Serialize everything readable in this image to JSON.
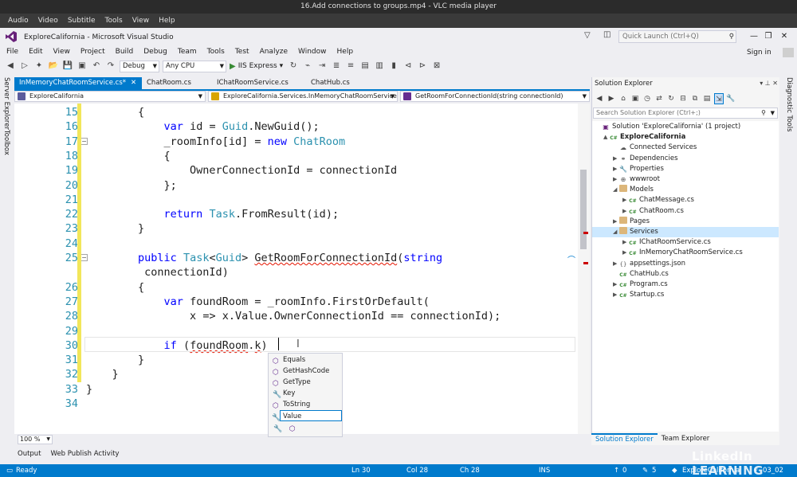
{
  "vlc": {
    "title": "16.Add connections to groups.mp4 - VLC media player",
    "menu": [
      "Audio",
      "Video",
      "Subtitle",
      "Tools",
      "View",
      "Help"
    ]
  },
  "vs": {
    "title": "ExploreCalifornia - Microsoft Visual Studio",
    "quick_launch": "Quick Launch (Ctrl+Q)",
    "menu": [
      "File",
      "Edit",
      "View",
      "Project",
      "Build",
      "Debug",
      "Team",
      "Tools",
      "Test",
      "Analyze",
      "Window",
      "Help"
    ],
    "sign_in": "Sign in",
    "toolbar": {
      "config": "Debug",
      "platform": "Any CPU",
      "run": "IIS Express"
    }
  },
  "side_tabs": {
    "left": [
      "Server Explorer",
      "Toolbox"
    ],
    "right": [
      "Diagnostic Tools"
    ]
  },
  "doc_tabs": [
    {
      "label": "InMemoryChatRoomService.cs*",
      "active": true
    },
    {
      "label": "ChatRoom.cs",
      "active": false
    },
    {
      "label": "IChatRoomService.cs",
      "active": false
    },
    {
      "label": "ChatHub.cs",
      "active": false
    }
  ],
  "navbar": {
    "project": "ExploreCalifornia",
    "type": "ExploreCalifornia.Services.InMemoryChatRoomService",
    "member": "GetRoomForConnectionId(string connectionId)"
  },
  "code": [
    {
      "num": "15",
      "text": "        {"
    },
    {
      "num": "16",
      "text": "            var id = Guid.NewGuid();"
    },
    {
      "num": "17",
      "text": "            _roomInfo[id] = new ChatRoom"
    },
    {
      "num": "18",
      "text": "            {"
    },
    {
      "num": "19",
      "text": "                OwnerConnectionId = connectionId"
    },
    {
      "num": "20",
      "text": "            };"
    },
    {
      "num": "21",
      "text": ""
    },
    {
      "num": "22",
      "text": "            return Task.FromResult(id);"
    },
    {
      "num": "23",
      "text": "        }"
    },
    {
      "num": "24",
      "text": ""
    },
    {
      "num": "25",
      "text": "        public Task<Guid> GetRoomForConnectionId(string"
    },
    {
      "num": "",
      "text": "         connectionId)"
    },
    {
      "num": "26",
      "text": "        {"
    },
    {
      "num": "27",
      "text": "            var foundRoom = _roomInfo.FirstOrDefault("
    },
    {
      "num": "28",
      "text": "                x => x.Value.OwnerConnectionId == connectionId);"
    },
    {
      "num": "29",
      "text": ""
    },
    {
      "num": "30",
      "text": "            if (foundRoom.k)"
    },
    {
      "num": "31",
      "text": "        }"
    },
    {
      "num": "32",
      "text": "    }"
    },
    {
      "num": "33",
      "text": "}"
    },
    {
      "num": "34",
      "text": ""
    }
  ],
  "intellisense": [
    {
      "label": "Equals",
      "icon": "method-icon"
    },
    {
      "label": "GetHashCode",
      "icon": "method-icon"
    },
    {
      "label": "GetType",
      "icon": "method-icon"
    },
    {
      "label": "Key",
      "icon": "property-icon"
    },
    {
      "label": "ToString",
      "icon": "method-icon"
    },
    {
      "label": "Value",
      "icon": "property-icon",
      "selected": true
    }
  ],
  "zoom": "100 %",
  "bottom_tabs": [
    "Output",
    "Web Publish Activity"
  ],
  "status": {
    "ready": "Ready",
    "ln": "Ln 30",
    "col": "Col 28",
    "ch": "Ch 28",
    "ins": "INS",
    "up": "0",
    "pencil": "5",
    "repo": "ExploreCalifornia",
    "branch": "03_02"
  },
  "solution_explorer": {
    "title": "Solution Explorer",
    "search": "Search Solution Explorer (Ctrl+;)",
    "tree": [
      {
        "label": "Solution 'ExploreCalifornia' (1 project)",
        "indent": 0,
        "icon": "solution"
      },
      {
        "label": "ExploreCalifornia",
        "indent": 1,
        "icon": "project",
        "bold": true,
        "exp": "▲"
      },
      {
        "label": "Connected Services",
        "indent": 2,
        "icon": "connected"
      },
      {
        "label": "Dependencies",
        "indent": 2,
        "icon": "deps",
        "exp": "▶"
      },
      {
        "label": "Properties",
        "indent": 2,
        "icon": "wrench",
        "exp": "▶"
      },
      {
        "label": "wwwroot",
        "indent": 2,
        "icon": "globe",
        "exp": "▶"
      },
      {
        "label": "Models",
        "indent": 2,
        "icon": "folder",
        "exp": "◢"
      },
      {
        "label": "ChatMessage.cs",
        "indent": 3,
        "icon": "cs",
        "exp": "▶"
      },
      {
        "label": "ChatRoom.cs",
        "indent": 3,
        "icon": "cs",
        "exp": "▶"
      },
      {
        "label": "Pages",
        "indent": 2,
        "icon": "folder",
        "exp": "▶"
      },
      {
        "label": "Services",
        "indent": 2,
        "icon": "folder",
        "exp": "◢",
        "selected": true
      },
      {
        "label": "IChatRoomService.cs",
        "indent": 3,
        "icon": "cs",
        "exp": "▶"
      },
      {
        "label": "InMemoryChatRoomService.cs",
        "indent": 3,
        "icon": "cs",
        "exp": "▶"
      },
      {
        "label": "appsettings.json",
        "indent": 2,
        "icon": "json",
        "exp": "▶"
      },
      {
        "label": "ChatHub.cs",
        "indent": 2,
        "icon": "cs"
      },
      {
        "label": "Program.cs",
        "indent": 2,
        "icon": "cs",
        "exp": "▶"
      },
      {
        "label": "Startup.cs",
        "indent": 2,
        "icon": "cs",
        "exp": "▶"
      }
    ],
    "bottom_tabs": [
      "Solution Explorer",
      "Team Explorer"
    ]
  },
  "watermark": "LinkedIn LEARNING"
}
